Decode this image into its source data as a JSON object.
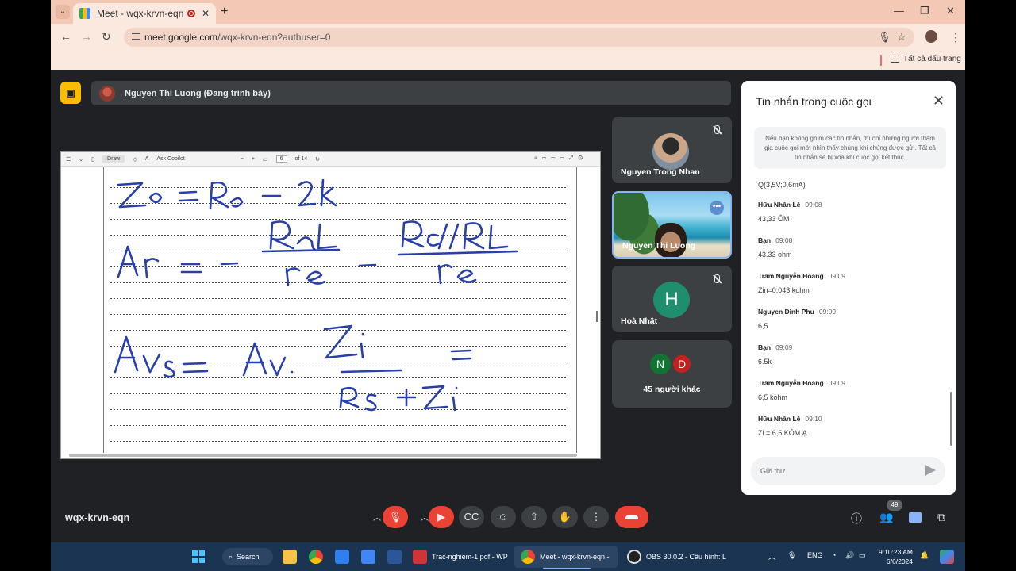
{
  "browser": {
    "tab_title": "Meet - wqx-krvn-eqn",
    "url_host": "meet.google.com",
    "url_path": "/wqx-krvn-eqn?authuser=0",
    "bookmarks_all": "Tất cả dấu trang"
  },
  "meet": {
    "presenter_label": "Nguyen Thi Luong (Đang trình bày)",
    "meeting_code": "wqx-krvn-eqn",
    "participants_count": "49",
    "pdf_toolbar": {
      "draw": "Draw",
      "ask": "Ask Copilot",
      "page_current": "6",
      "page_total": "of 14"
    },
    "tiles": [
      {
        "name": "Nguyen Trong Nhan"
      },
      {
        "name": "Nguyen Thi Luong"
      },
      {
        "name": "Hoà Nhật",
        "initial": "H"
      },
      {
        "initials": [
          "N",
          "D"
        ],
        "name": "45 người khác"
      }
    ]
  },
  "chat": {
    "title": "Tin nhắn trong cuộc gọi",
    "note": "Nếu bạn không ghim các tin nhắn, thì chỉ những người tham gia cuộc gọi mới nhìn thấy chúng khi chúng được gửi. Tất cả tin nhắn sẽ bị xoá khi cuộc gọi kết thúc.",
    "first_message": "Q(3,5V;0,6mA)",
    "messages": [
      {
        "sender": "Hữu Nhân Lê",
        "time": "09:08",
        "text": "43,33 ÔM"
      },
      {
        "sender": "Bạn",
        "time": "09:08",
        "text": "43.33 ohm"
      },
      {
        "sender": "Trâm Nguyễn Hoàng",
        "time": "09:09",
        "text": "Zin=0,043 kohm"
      },
      {
        "sender": "Nguyen Dinh Phu",
        "time": "09:09",
        "text": "6,5"
      },
      {
        "sender": "Bạn",
        "time": "09:09",
        "text": "6.5k"
      },
      {
        "sender": "Trâm Nguyễn Hoàng",
        "time": "09:09",
        "text": "6,5 kohm"
      },
      {
        "sender": "Hữu Nhân Lê",
        "time": "09:10",
        "text": "Zi = 6,5 KÔM Ạ"
      }
    ],
    "input_placeholder": "Gửi thư"
  },
  "taskbar": {
    "search": "Search",
    "tasks": [
      {
        "label": "Trac-nghiem-1.pdf - WP"
      },
      {
        "label": "Meet - wqx-krvn-eqn - "
      },
      {
        "label": "OBS 30.0.2 - Cấu hình: L"
      }
    ],
    "lang": "ENG",
    "time": "9:10:23 AM",
    "date": "6/6/2024"
  }
}
